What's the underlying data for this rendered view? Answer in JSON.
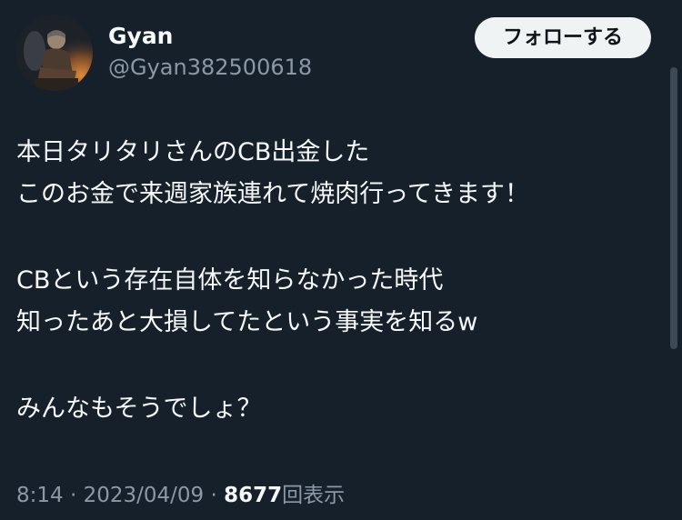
{
  "user": {
    "display_name": "Gyan",
    "handle": "@Gyan382500618"
  },
  "follow_label": "フォローする",
  "tweet": {
    "lines": [
      "本日タリタリさんのCB出金した",
      "このお金で来週家族連れて焼肉行ってきます！",
      "",
      "CBという存在自体を知らなかった時代",
      "知ったあと大損してたという事実を知るw",
      "",
      "みんなもそうでしょ？"
    ]
  },
  "meta": {
    "time": "8:14",
    "separator": " · ",
    "date": "2023/04/09",
    "views_count": "8677",
    "views_label": "回表示"
  },
  "colors": {
    "background": "#15202b",
    "primary_text": "#f7f9f9",
    "secondary_text": "#8b98a5",
    "follow_button_bg": "#eff3f4",
    "follow_button_text": "#0f1419"
  }
}
